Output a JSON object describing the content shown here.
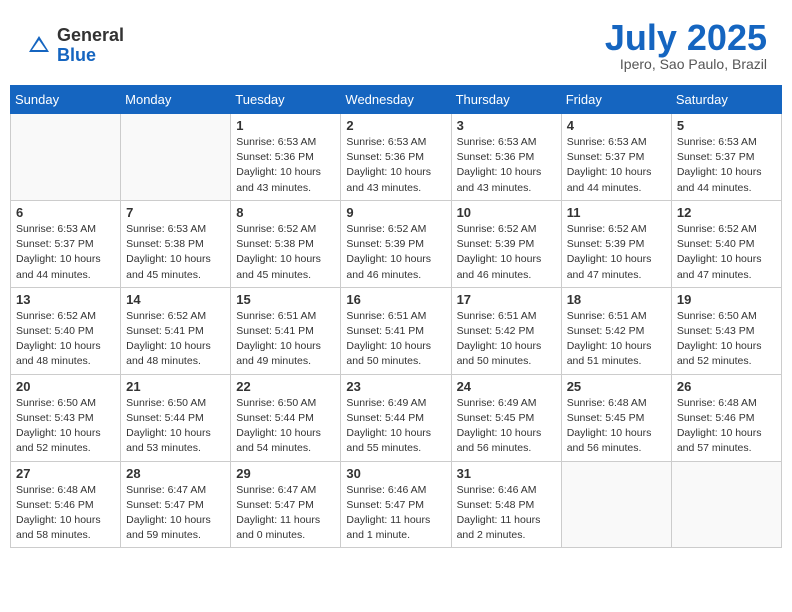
{
  "header": {
    "logo_general": "General",
    "logo_blue": "Blue",
    "month_title": "July 2025",
    "location": "Ipero, Sao Paulo, Brazil"
  },
  "weekdays": [
    "Sunday",
    "Monday",
    "Tuesday",
    "Wednesday",
    "Thursday",
    "Friday",
    "Saturday"
  ],
  "weeks": [
    [
      {
        "day": "",
        "sunrise": "",
        "sunset": "",
        "daylight": ""
      },
      {
        "day": "",
        "sunrise": "",
        "sunset": "",
        "daylight": ""
      },
      {
        "day": "1",
        "sunrise": "Sunrise: 6:53 AM",
        "sunset": "Sunset: 5:36 PM",
        "daylight": "Daylight: 10 hours and 43 minutes."
      },
      {
        "day": "2",
        "sunrise": "Sunrise: 6:53 AM",
        "sunset": "Sunset: 5:36 PM",
        "daylight": "Daylight: 10 hours and 43 minutes."
      },
      {
        "day": "3",
        "sunrise": "Sunrise: 6:53 AM",
        "sunset": "Sunset: 5:36 PM",
        "daylight": "Daylight: 10 hours and 43 minutes."
      },
      {
        "day": "4",
        "sunrise": "Sunrise: 6:53 AM",
        "sunset": "Sunset: 5:37 PM",
        "daylight": "Daylight: 10 hours and 44 minutes."
      },
      {
        "day": "5",
        "sunrise": "Sunrise: 6:53 AM",
        "sunset": "Sunset: 5:37 PM",
        "daylight": "Daylight: 10 hours and 44 minutes."
      }
    ],
    [
      {
        "day": "6",
        "sunrise": "Sunrise: 6:53 AM",
        "sunset": "Sunset: 5:37 PM",
        "daylight": "Daylight: 10 hours and 44 minutes."
      },
      {
        "day": "7",
        "sunrise": "Sunrise: 6:53 AM",
        "sunset": "Sunset: 5:38 PM",
        "daylight": "Daylight: 10 hours and 45 minutes."
      },
      {
        "day": "8",
        "sunrise": "Sunrise: 6:52 AM",
        "sunset": "Sunset: 5:38 PM",
        "daylight": "Daylight: 10 hours and 45 minutes."
      },
      {
        "day": "9",
        "sunrise": "Sunrise: 6:52 AM",
        "sunset": "Sunset: 5:39 PM",
        "daylight": "Daylight: 10 hours and 46 minutes."
      },
      {
        "day": "10",
        "sunrise": "Sunrise: 6:52 AM",
        "sunset": "Sunset: 5:39 PM",
        "daylight": "Daylight: 10 hours and 46 minutes."
      },
      {
        "day": "11",
        "sunrise": "Sunrise: 6:52 AM",
        "sunset": "Sunset: 5:39 PM",
        "daylight": "Daylight: 10 hours and 47 minutes."
      },
      {
        "day": "12",
        "sunrise": "Sunrise: 6:52 AM",
        "sunset": "Sunset: 5:40 PM",
        "daylight": "Daylight: 10 hours and 47 minutes."
      }
    ],
    [
      {
        "day": "13",
        "sunrise": "Sunrise: 6:52 AM",
        "sunset": "Sunset: 5:40 PM",
        "daylight": "Daylight: 10 hours and 48 minutes."
      },
      {
        "day": "14",
        "sunrise": "Sunrise: 6:52 AM",
        "sunset": "Sunset: 5:41 PM",
        "daylight": "Daylight: 10 hours and 48 minutes."
      },
      {
        "day": "15",
        "sunrise": "Sunrise: 6:51 AM",
        "sunset": "Sunset: 5:41 PM",
        "daylight": "Daylight: 10 hours and 49 minutes."
      },
      {
        "day": "16",
        "sunrise": "Sunrise: 6:51 AM",
        "sunset": "Sunset: 5:41 PM",
        "daylight": "Daylight: 10 hours and 50 minutes."
      },
      {
        "day": "17",
        "sunrise": "Sunrise: 6:51 AM",
        "sunset": "Sunset: 5:42 PM",
        "daylight": "Daylight: 10 hours and 50 minutes."
      },
      {
        "day": "18",
        "sunrise": "Sunrise: 6:51 AM",
        "sunset": "Sunset: 5:42 PM",
        "daylight": "Daylight: 10 hours and 51 minutes."
      },
      {
        "day": "19",
        "sunrise": "Sunrise: 6:50 AM",
        "sunset": "Sunset: 5:43 PM",
        "daylight": "Daylight: 10 hours and 52 minutes."
      }
    ],
    [
      {
        "day": "20",
        "sunrise": "Sunrise: 6:50 AM",
        "sunset": "Sunset: 5:43 PM",
        "daylight": "Daylight: 10 hours and 52 minutes."
      },
      {
        "day": "21",
        "sunrise": "Sunrise: 6:50 AM",
        "sunset": "Sunset: 5:44 PM",
        "daylight": "Daylight: 10 hours and 53 minutes."
      },
      {
        "day": "22",
        "sunrise": "Sunrise: 6:50 AM",
        "sunset": "Sunset: 5:44 PM",
        "daylight": "Daylight: 10 hours and 54 minutes."
      },
      {
        "day": "23",
        "sunrise": "Sunrise: 6:49 AM",
        "sunset": "Sunset: 5:44 PM",
        "daylight": "Daylight: 10 hours and 55 minutes."
      },
      {
        "day": "24",
        "sunrise": "Sunrise: 6:49 AM",
        "sunset": "Sunset: 5:45 PM",
        "daylight": "Daylight: 10 hours and 56 minutes."
      },
      {
        "day": "25",
        "sunrise": "Sunrise: 6:48 AM",
        "sunset": "Sunset: 5:45 PM",
        "daylight": "Daylight: 10 hours and 56 minutes."
      },
      {
        "day": "26",
        "sunrise": "Sunrise: 6:48 AM",
        "sunset": "Sunset: 5:46 PM",
        "daylight": "Daylight: 10 hours and 57 minutes."
      }
    ],
    [
      {
        "day": "27",
        "sunrise": "Sunrise: 6:48 AM",
        "sunset": "Sunset: 5:46 PM",
        "daylight": "Daylight: 10 hours and 58 minutes."
      },
      {
        "day": "28",
        "sunrise": "Sunrise: 6:47 AM",
        "sunset": "Sunset: 5:47 PM",
        "daylight": "Daylight: 10 hours and 59 minutes."
      },
      {
        "day": "29",
        "sunrise": "Sunrise: 6:47 AM",
        "sunset": "Sunset: 5:47 PM",
        "daylight": "Daylight: 11 hours and 0 minutes."
      },
      {
        "day": "30",
        "sunrise": "Sunrise: 6:46 AM",
        "sunset": "Sunset: 5:47 PM",
        "daylight": "Daylight: 11 hours and 1 minute."
      },
      {
        "day": "31",
        "sunrise": "Sunrise: 6:46 AM",
        "sunset": "Sunset: 5:48 PM",
        "daylight": "Daylight: 11 hours and 2 minutes."
      },
      {
        "day": "",
        "sunrise": "",
        "sunset": "",
        "daylight": ""
      },
      {
        "day": "",
        "sunrise": "",
        "sunset": "",
        "daylight": ""
      }
    ]
  ]
}
